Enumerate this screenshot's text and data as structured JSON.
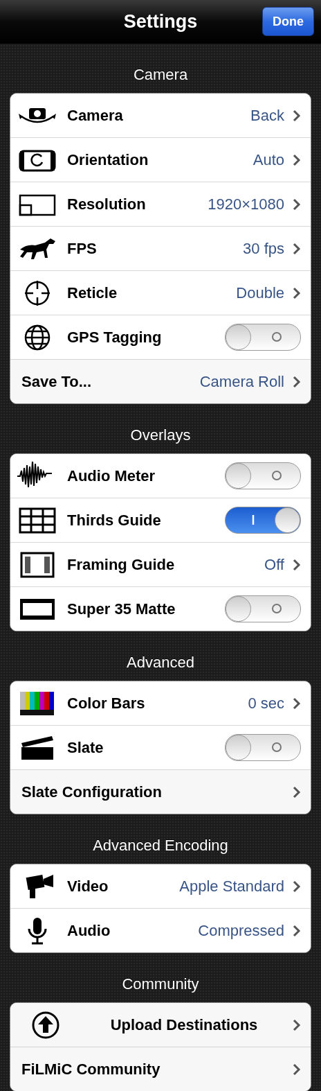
{
  "nav": {
    "title": "Settings",
    "done": "Done"
  },
  "sections": [
    {
      "header": "Camera",
      "rows": [
        {
          "kind": "value",
          "label": "Camera",
          "value": "Back"
        },
        {
          "kind": "value",
          "label": "Orientation",
          "value": "Auto"
        },
        {
          "kind": "value",
          "label": "Resolution",
          "value": "1920×1080"
        },
        {
          "kind": "value",
          "label": "FPS",
          "value": "30 fps"
        },
        {
          "kind": "value",
          "label": "Reticle",
          "value": "Double"
        },
        {
          "kind": "toggle",
          "label": "GPS Tagging",
          "on": false
        },
        {
          "kind": "value",
          "label": "Save To...",
          "value": "Camera Roll"
        }
      ]
    },
    {
      "header": "Overlays",
      "rows": [
        {
          "kind": "toggle",
          "label": "Audio Meter",
          "on": false
        },
        {
          "kind": "toggle",
          "label": "Thirds Guide",
          "on": true
        },
        {
          "kind": "value",
          "label": "Framing Guide",
          "value": "Off"
        },
        {
          "kind": "toggle",
          "label": "Super 35 Matte",
          "on": false
        }
      ]
    },
    {
      "header": "Advanced",
      "rows": [
        {
          "kind": "value",
          "label": "Color Bars",
          "value": "0 sec"
        },
        {
          "kind": "toggle",
          "label": "Slate",
          "on": false
        },
        {
          "kind": "link",
          "label": "Slate Configuration"
        }
      ]
    },
    {
      "header": "Advanced Encoding",
      "rows": [
        {
          "kind": "value",
          "label": "Video",
          "value": "Apple Standard"
        },
        {
          "kind": "value",
          "label": "Audio",
          "value": "Compressed"
        }
      ]
    },
    {
      "header": "Community",
      "rows": [
        {
          "kind": "link",
          "label": "Upload Destinations"
        },
        {
          "kind": "link",
          "label": "FiLMiC Community"
        }
      ]
    }
  ]
}
